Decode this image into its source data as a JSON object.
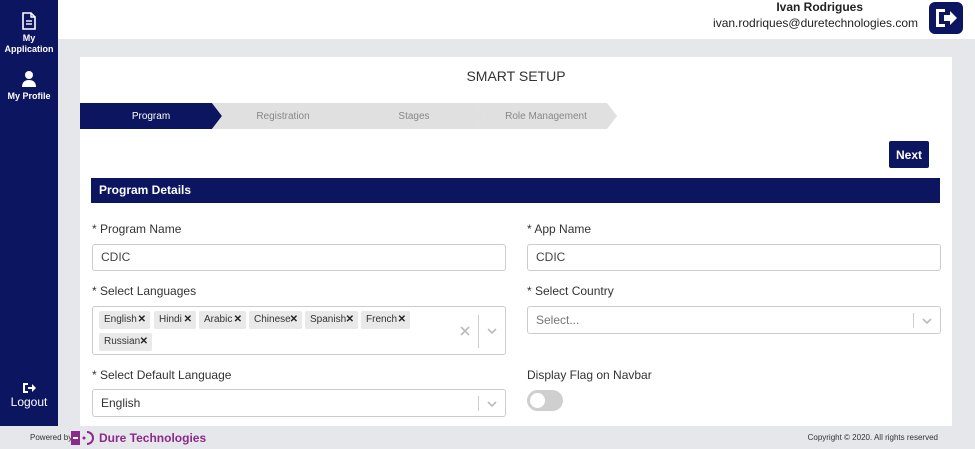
{
  "sidebar": {
    "items": [
      {
        "label_line1": "My",
        "label_line2": "Application",
        "icon": "document-icon"
      },
      {
        "label": "My Profile",
        "icon": "user-icon"
      }
    ],
    "logout_label": "Logout"
  },
  "header": {
    "user_name": "Ivan Rodrigues",
    "user_email": "ivan.rodriques@duretechnologies.com"
  },
  "page": {
    "title": "SMART SETUP",
    "steps": [
      {
        "label": "Program",
        "active": true
      },
      {
        "label": "Registration",
        "active": false
      },
      {
        "label": "Stages",
        "active": false
      },
      {
        "label": "Role Management",
        "active": false
      }
    ],
    "next_label": "Next"
  },
  "form": {
    "section_title": "Program Details",
    "program_name_label": "* Program Name",
    "program_name_value": "CDIC",
    "app_name_label": "* App Name",
    "app_name_value": "CDIC",
    "languages_label": "* Select Languages",
    "languages": [
      "English",
      "Hindi",
      "Arabic",
      "Chinese",
      "Spanish",
      "French",
      "Russian"
    ],
    "country_label": "* Select Country",
    "country_placeholder": "Select...",
    "default_language_label": "* Select Default Language",
    "default_language_value": "English",
    "display_flag_label": "Display Flag on Navbar",
    "display_flag_on": false
  },
  "footer": {
    "powered_by": "Powered by",
    "brand": "Dure Technologies",
    "copyright": "Copyright © 2020. All rights reserved"
  },
  "colors": {
    "primary": "#0c1560",
    "step_inactive": "#e0e0e0",
    "brand": "#8a2a8a"
  }
}
